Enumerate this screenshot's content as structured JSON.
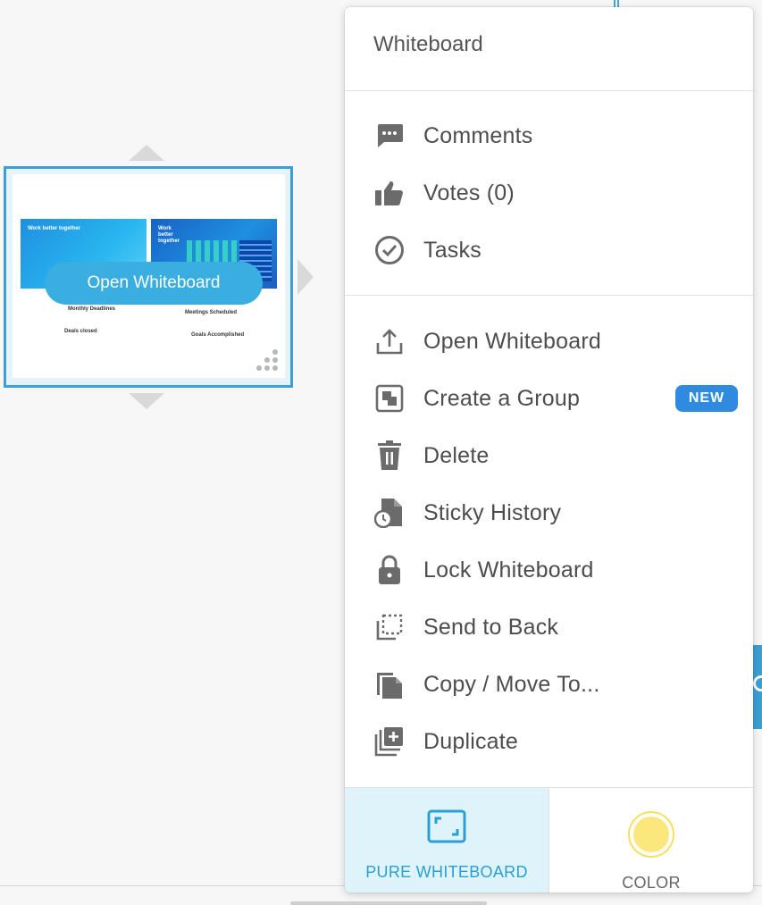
{
  "whiteboard_preview": {
    "open_label": "Open Whiteboard",
    "slide_title": "Work better together",
    "slide_title_2": "Work better together",
    "labels": [
      "Monthly Deadlines",
      "Meetings Scheduled",
      "Deals closed",
      "Goals Accomplished"
    ]
  },
  "menu": {
    "title": "Whiteboard",
    "section1": [
      {
        "label": "Comments",
        "icon": "comment-icon"
      },
      {
        "label": "Votes (0)",
        "icon": "thumbs-up-icon"
      },
      {
        "label": "Tasks",
        "icon": "check-circle-icon"
      }
    ],
    "section2": [
      {
        "label": "Open Whiteboard",
        "icon": "upload-icon"
      },
      {
        "label": "Create a Group",
        "icon": "group-icon",
        "badge": "NEW"
      },
      {
        "label": "Delete",
        "icon": "trash-icon"
      },
      {
        "label": "Sticky History",
        "icon": "history-icon"
      },
      {
        "label": "Lock Whiteboard",
        "icon": "lock-icon"
      },
      {
        "label": "Send to Back",
        "icon": "send-back-icon"
      },
      {
        "label": "Copy / Move To...",
        "icon": "copy-icon"
      },
      {
        "label": "Duplicate",
        "icon": "duplicate-icon"
      }
    ],
    "footer": {
      "pure_label": "PURE WHITEBOARD",
      "color_label": "COLOR",
      "color_value": "#fbe77c"
    }
  },
  "colors": {
    "accent": "#3aaee0",
    "badge": "#2f8ae0",
    "active_bg": "#dff3fb"
  }
}
